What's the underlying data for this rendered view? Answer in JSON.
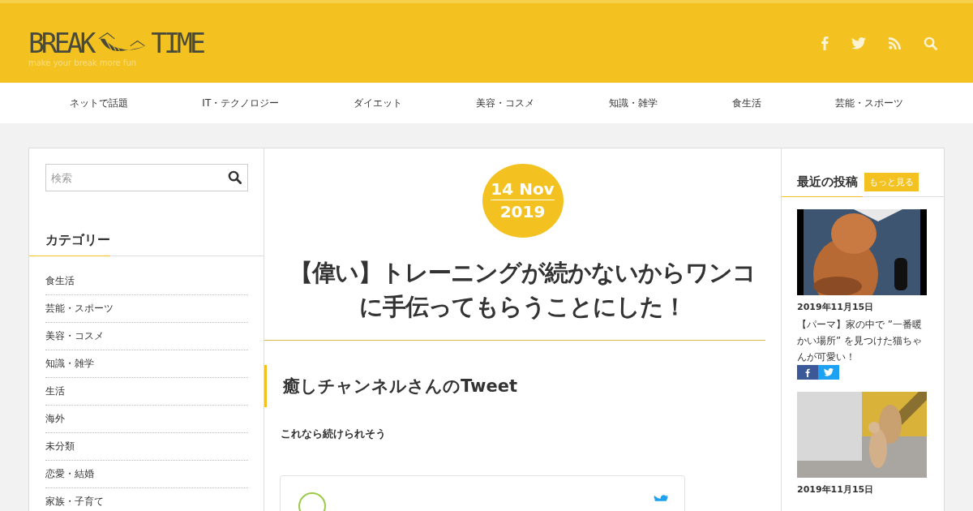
{
  "logo": {
    "word_left": "BREAK",
    "word_right": "TIME",
    "tagline": "make your break more fun"
  },
  "header_icons": [
    {
      "kind": "facebook"
    },
    {
      "kind": "twitter"
    },
    {
      "kind": "rss"
    },
    {
      "kind": "search"
    }
  ],
  "nav": [
    "ネットで話題",
    "IT・テクノロジー",
    "ダイエット",
    "美容・コスメ",
    "知識・雑学",
    "食生活",
    "芸能・スポーツ"
  ],
  "sidebar": {
    "search": {
      "placeholder": "検索"
    },
    "heading": "カテゴリー",
    "categories": [
      "食生活",
      "芸能・スポーツ",
      "美容・コスメ",
      "知識・雑学",
      "生活",
      "海外",
      "未分類",
      "恋愛・結婚",
      "家族・子育て"
    ]
  },
  "article": {
    "date_day": "14 Nov",
    "date_year": "2019",
    "title": "【偉い】トレーニングが続かないからワンコに手伝ってもらうことにした！",
    "section_heading": "癒しチャンネルさんのTweet",
    "body": "これなら続けられそう"
  },
  "recent": {
    "heading": "最近の投稿",
    "more_button": "もっと見る",
    "posts": [
      {
        "kind": "cat",
        "date": "2019年11月15日",
        "title": "【パーマ】家の中で ”一番暖かい場所” を見つけた猫ちゃんが可愛い！",
        "share": true
      },
      {
        "kind": "dog",
        "date": "2019年11月15日",
        "share": false
      }
    ]
  }
}
